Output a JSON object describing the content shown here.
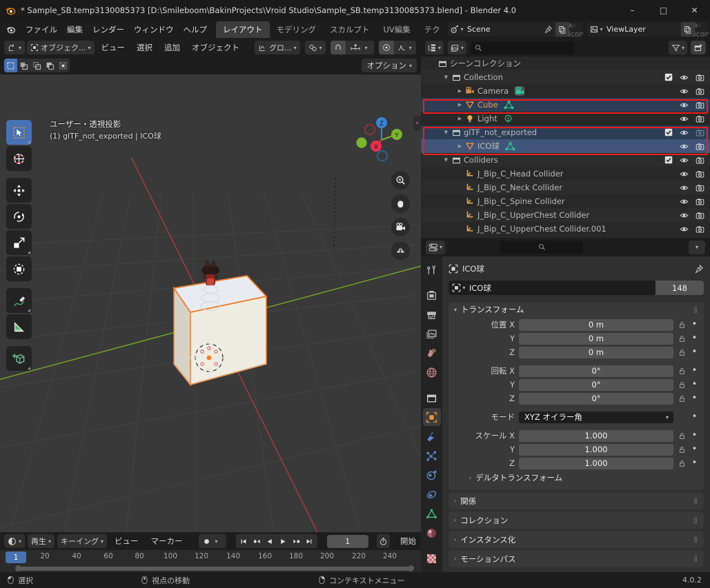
{
  "titlebar": {
    "title": "* Sample_SB.temp3130085373 [D:\\Smileboom\\BakinProjects\\Vroid Studio\\Sample_SB.temp3130085373.blend] - Blender 4.0",
    "minimize": "–",
    "maximize": "□",
    "close": "✕",
    "logo_icon": "blender-logo-icon"
  },
  "topbar": {
    "menus": [
      "ファイル",
      "編集",
      "レンダー",
      "ウィンドウ",
      "ヘルプ"
    ],
    "workspaces": [
      {
        "label": "レイアウト",
        "active": true
      },
      {
        "label": "モデリング",
        "active": false
      },
      {
        "label": "スカルプト",
        "active": false
      },
      {
        "label": "UV編集",
        "active": false
      },
      {
        "label": "テク",
        "active": false
      }
    ],
    "scene": {
      "name": "Scene",
      "icon": "scene-icon",
      "pin_icon": "pin-icon",
      "new_icon": "copy-icon",
      "unlink_icon": "x-icon"
    },
    "viewlayer": {
      "name": "ViewLayer",
      "icon": "viewlayer-icon",
      "new_icon": "copy-icon",
      "unlink_icon": "x-icon"
    }
  },
  "viewport": {
    "header": {
      "editor_type": "editor-type-3dview-icon",
      "mode": "オブジェク...",
      "menus": [
        "ビュー",
        "選択",
        "追加",
        "オブジェクト"
      ],
      "transform_orientation": "グロ...",
      "snap_icon": "magnet-icon",
      "proportional_icon": "proportional-edit-icon"
    },
    "header2": {
      "select_modes": [
        "set-select-icon",
        "extend-select-icon",
        "subtract-select-icon",
        "invert-select-icon",
        "intersect-select-icon"
      ],
      "options_label": "オプション"
    },
    "overlay": {
      "line1": "ユーザー・透視投影",
      "line2": "(1) glTF_not_exported | ICO球"
    },
    "tools": [
      {
        "name": "tweak-tool",
        "icon": "cursor-arrow-icon",
        "active": true
      },
      {
        "name": "cursor-tool",
        "icon": "3d-cursor-icon",
        "active": false
      },
      {
        "name": "move-tool",
        "icon": "move-icon",
        "active": false
      },
      {
        "name": "rotate-tool",
        "icon": "rotate-icon",
        "active": false
      },
      {
        "name": "scale-tool",
        "icon": "scale-icon",
        "active": false
      },
      {
        "name": "transform-tool",
        "icon": "transform-icon",
        "active": false
      },
      {
        "name": "annotate-tool",
        "icon": "pencil-icon",
        "active": false
      },
      {
        "name": "measure-tool",
        "icon": "ruler-icon",
        "active": false
      },
      {
        "name": "add-cube-tool",
        "icon": "add-cube-icon",
        "active": false
      }
    ],
    "gizmo": {
      "x": "X",
      "y": "Y",
      "z": "Z"
    },
    "nav_buttons": [
      "zoom-icon",
      "pan-hand-icon",
      "camera-view-icon",
      "toggle-ortho-icon"
    ],
    "collapse_icon": "chevron-left-icon"
  },
  "timeline": {
    "editor_icon": "timeline-editor-icon",
    "menus": [
      "再生",
      "キーイング",
      "ビュー",
      "マーカー"
    ],
    "record_icon": "record-icon",
    "transport": [
      "jump-start-icon",
      "prev-keyframe-icon",
      "play-reverse-icon",
      "play-icon",
      "next-keyframe-icon",
      "jump-end-icon"
    ],
    "current_frame": "1",
    "autokey_icon": "stopwatch-icon",
    "start_label": "開始",
    "ticks": [
      "20",
      "40",
      "60",
      "80",
      "100",
      "120",
      "140",
      "160",
      "180",
      "200",
      "220",
      "240"
    ],
    "playhead_label": "1"
  },
  "statusbar": {
    "items": [
      {
        "icon": "mouse-left-icon",
        "label": "選択"
      },
      {
        "icon": "mouse-middle-icon",
        "label": "視点の移動"
      },
      {
        "icon": "mouse-right-icon",
        "label": "コンテキストメニュー"
      }
    ],
    "version": "4.0.2"
  },
  "outliner": {
    "header": {
      "display_mode_icon": "outliner-display-mode-icon",
      "filter_id_icon": "filter-id-icon",
      "search_icon": "search-icon",
      "search_placeholder": "",
      "filter_icon": "funnel-icon",
      "new_collection_icon": "new-collection-icon"
    },
    "rows": [
      {
        "name": "シーンコレクション",
        "icon": "scene-collection-icon",
        "indent": 0,
        "disclosure": "",
        "checkbox": false,
        "eye": false,
        "camera": false,
        "style": "dim",
        "state": "none"
      },
      {
        "name": "Collection",
        "icon": "collection-icon",
        "indent": 1,
        "disclosure": "▼",
        "checkbox": true,
        "eye": true,
        "camera": true,
        "style": "dim",
        "state": "none"
      },
      {
        "name": "Camera",
        "icon": "camera-object-icon",
        "data_icon": "camera-data-icon",
        "indent": 2,
        "disclosure": "▶",
        "checkbox": false,
        "eye": true,
        "camera": true,
        "style": "dim",
        "state": "none"
      },
      {
        "name": "Cube",
        "icon": "mesh-object-icon",
        "data_icon": "mesh-data-icon",
        "indent": 2,
        "disclosure": "▶",
        "checkbox": false,
        "eye": true,
        "camera": true,
        "style": "orange",
        "state": "selected"
      },
      {
        "name": "Light",
        "icon": "light-object-icon",
        "data_icon": "light-data-icon",
        "indent": 2,
        "disclosure": "▶",
        "checkbox": false,
        "eye": true,
        "camera": true,
        "style": "dim",
        "state": "none"
      },
      {
        "name": "glTF_not_exported",
        "icon": "collection-icon",
        "indent": 1,
        "disclosure": "▼",
        "checkbox": true,
        "eye": true,
        "camera": "disabled",
        "style": "dim",
        "state": "selected"
      },
      {
        "name": "ICO球",
        "icon": "mesh-object-icon",
        "data_icon": "mesh-data-icon",
        "indent": 2,
        "disclosure": "▶",
        "checkbox": false,
        "eye": true,
        "camera": true,
        "style": "dim",
        "state": "active"
      },
      {
        "name": "Colliders",
        "icon": "collection-icon",
        "indent": 1,
        "disclosure": "▼",
        "checkbox": true,
        "eye": true,
        "camera": true,
        "style": "dim",
        "state": "none"
      },
      {
        "name": "J_Bip_C_Head Collider",
        "icon": "empty-object-icon",
        "indent": 2,
        "disclosure": "",
        "checkbox": false,
        "eye": true,
        "camera": true,
        "style": "dim",
        "state": "none"
      },
      {
        "name": "J_Bip_C_Neck Collider",
        "icon": "empty-object-icon",
        "indent": 2,
        "disclosure": "",
        "checkbox": false,
        "eye": true,
        "camera": true,
        "style": "dim",
        "state": "none"
      },
      {
        "name": "J_Bip_C_Spine Collider",
        "icon": "empty-object-icon",
        "indent": 2,
        "disclosure": "",
        "checkbox": false,
        "eye": true,
        "camera": true,
        "style": "dim",
        "state": "none"
      },
      {
        "name": "J_Bip_C_UpperChest Collider",
        "icon": "empty-object-icon",
        "indent": 2,
        "disclosure": "",
        "checkbox": false,
        "eye": true,
        "camera": true,
        "style": "dim",
        "state": "none"
      },
      {
        "name": "J_Bip_C_UpperChest Collider.001",
        "icon": "empty-object-icon",
        "indent": 2,
        "disclosure": "",
        "checkbox": false,
        "eye": true,
        "camera": true,
        "style": "dim",
        "state": "none"
      }
    ],
    "highlight_color": "#f01c1c"
  },
  "properties": {
    "header": {
      "editor_icon": "properties-editor-icon",
      "search_icon": "search-icon",
      "more_icon": "chevron-down-icon"
    },
    "tabs": [
      {
        "name": "tool",
        "icon": "tool-icon",
        "active": false
      },
      {
        "name": "render",
        "icon": "render-icon",
        "active": false
      },
      {
        "name": "output",
        "icon": "printer-icon",
        "active": false
      },
      {
        "name": "view-layer",
        "icon": "images-icon",
        "active": false
      },
      {
        "name": "scene",
        "icon": "scene-props-icon",
        "active": false
      },
      {
        "name": "world",
        "icon": "world-icon",
        "active": false
      },
      {
        "name": "collection",
        "icon": "collection-props-icon",
        "active": false
      },
      {
        "name": "object",
        "icon": "object-props-icon",
        "active": true
      },
      {
        "name": "modifiers",
        "icon": "wrench-icon",
        "active": false
      },
      {
        "name": "particles",
        "icon": "particles-icon",
        "active": false
      },
      {
        "name": "physics",
        "icon": "physics-icon",
        "active": false
      },
      {
        "name": "constraints",
        "icon": "constraints-icon",
        "active": false
      },
      {
        "name": "data",
        "icon": "mesh-data-icon",
        "active": false
      },
      {
        "name": "material",
        "icon": "material-icon",
        "active": false
      },
      {
        "name": "texture",
        "icon": "texture-icon",
        "active": false
      }
    ],
    "breadcrumb": {
      "icon": "object-props-icon",
      "name": "ICO球",
      "pin_icon": "pin-icon"
    },
    "id_row": {
      "icon": "object-props-icon",
      "name": "ICO球",
      "users_count": "148"
    },
    "transform": {
      "title": "トランスフォーム",
      "location_label": "位置 X",
      "rotation_label": "回転 X",
      "scale_label": "スケール X",
      "y_label": "Y",
      "z_label": "Z",
      "mode_label": "モード",
      "location": {
        "x": "0 m",
        "y": "0 m",
        "z": "0 m"
      },
      "rotation": {
        "x": "0°",
        "y": "0°",
        "z": "0°"
      },
      "rotation_mode": "XYZ オイラー角",
      "scale": {
        "x": "1.000",
        "y": "1.000",
        "z": "1.000"
      },
      "delta_transform": "デルタトランスフォーム"
    },
    "closed_panels": [
      "関係",
      "コレクション",
      "インスタンス化",
      "モーションパス"
    ]
  }
}
